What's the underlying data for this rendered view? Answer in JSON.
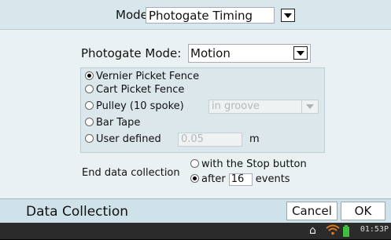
{
  "header": {
    "mode_label": "Mode:",
    "mode_value": "Photogate Timing"
  },
  "photogate": {
    "label": "Photogate Mode:",
    "value": "Motion"
  },
  "options": [
    {
      "label": "Vernier Picket Fence",
      "selected": true
    },
    {
      "label": "Cart Picket Fence",
      "selected": false
    },
    {
      "label": "Pulley (10 spoke)",
      "selected": false,
      "select_value": "in groove"
    },
    {
      "label": "Bar Tape",
      "selected": false
    },
    {
      "label": "User defined",
      "selected": false,
      "input_value": "0.05",
      "unit": "m"
    }
  ],
  "end_collection": {
    "label": "End data collection",
    "option_stop": "with the Stop button",
    "option_after_prefix": "after",
    "after_value": "16",
    "option_after_suffix": "events"
  },
  "footer": {
    "title": "Data Collection",
    "cancel": "Cancel",
    "ok": "OK"
  },
  "statusbar": {
    "time": "01:53P",
    "icons": [
      "home-icon",
      "wifi-icon",
      "battery-icon"
    ],
    "battery_color": "#3fbf3f",
    "wifi_color": "#e07a18"
  }
}
